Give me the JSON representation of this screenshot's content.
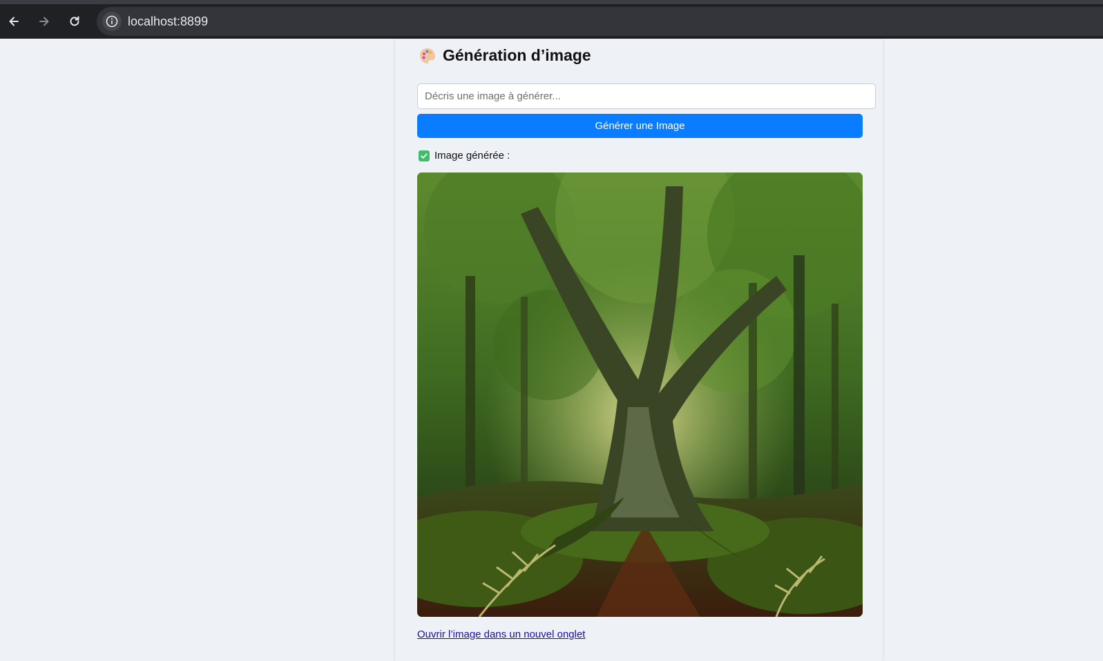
{
  "browser": {
    "url": "localhost:8899",
    "nav_icons": [
      "back-arrow-icon",
      "forward-arrow-icon",
      "reload-icon",
      "info-icon"
    ]
  },
  "app": {
    "title": "Génération d’image",
    "title_icon": "palette-icon",
    "prompt": {
      "value": "",
      "placeholder": "Décris une image à générer..."
    },
    "generate_label": "Générer une Image",
    "status": {
      "icon": "check-box-icon",
      "text": "Image générée :"
    },
    "open_link_label": "Ouvrir l’image dans un nouvel onglet"
  },
  "colors": {
    "accent": "#0a7cff",
    "success": "#3fbe6a",
    "link": "#1a0dab"
  }
}
